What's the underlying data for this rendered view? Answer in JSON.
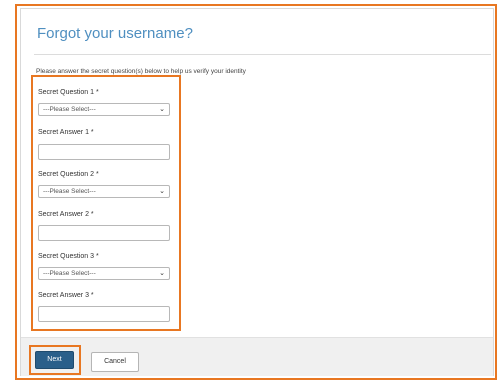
{
  "form": {
    "title": "Forgot your username?",
    "instructions": "Please answer the secret question(s) below to help us verify your identity",
    "question1_label": "Secret Question 1 *",
    "question1_value": "---Please Select---",
    "answer1_label": "Secret Answer 1 *",
    "question2_label": "Secret Question 2 *",
    "question2_value": "---Please Select---",
    "answer2_label": "Secret Answer 2 *",
    "question3_label": "Secret Question 3 *",
    "question3_value": "---Please Select---",
    "answer3_label": "Secret Answer 3 *",
    "answer1_value": "",
    "answer2_value": "",
    "answer3_value": ""
  },
  "buttons": {
    "next_label": "Next",
    "cancel_label": "Cancel"
  },
  "icons": {
    "dropdown": "chevron-down-icon"
  },
  "colors": {
    "highlight": "#e87722",
    "title": "#4f8fc0",
    "primary_button": "#2a5f8a",
    "footer_bg": "#f0f0f0"
  }
}
